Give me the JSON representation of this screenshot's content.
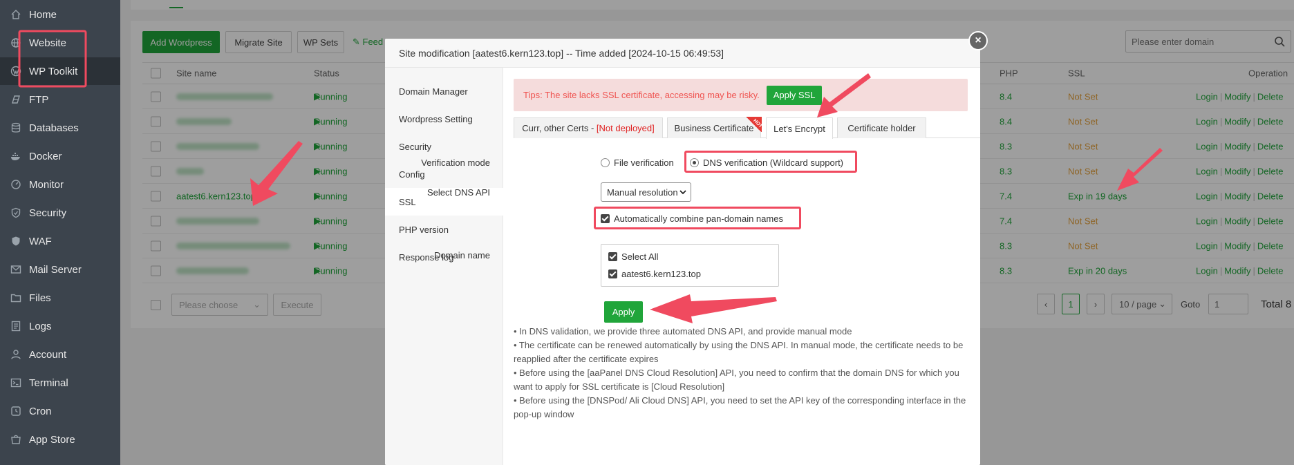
{
  "sidebar": {
    "items": [
      {
        "label": "Home",
        "icon": "home-icon"
      },
      {
        "label": "Website",
        "icon": "globe-icon"
      },
      {
        "label": "WP Toolkit",
        "icon": "wordpress-icon"
      },
      {
        "label": "FTP",
        "icon": "ftp-icon"
      },
      {
        "label": "Databases",
        "icon": "database-icon"
      },
      {
        "label": "Docker",
        "icon": "docker-icon"
      },
      {
        "label": "Monitor",
        "icon": "monitor-icon"
      },
      {
        "label": "Security",
        "icon": "shield-icon"
      },
      {
        "label": "WAF",
        "icon": "waf-icon"
      },
      {
        "label": "Mail Server",
        "icon": "mail-icon"
      },
      {
        "label": "Files",
        "icon": "folder-icon"
      },
      {
        "label": "Logs",
        "icon": "logs-icon"
      },
      {
        "label": "Account",
        "icon": "user-icon"
      },
      {
        "label": "Terminal",
        "icon": "terminal-icon"
      },
      {
        "label": "Cron",
        "icon": "clock-icon"
      },
      {
        "label": "App Store",
        "icon": "store-icon"
      }
    ]
  },
  "toolbar": {
    "add_wordpress": "Add Wordpress",
    "migrate_site": "Migrate Site",
    "wp_sets": "WP Sets",
    "feedback": "Feed",
    "search_placeholder": "Please enter domain"
  },
  "table": {
    "headers": {
      "site_name": "Site name",
      "status": "Status",
      "php": "PHP",
      "ssl": "SSL",
      "operation": "Operation"
    },
    "rows": [
      {
        "site": "",
        "status": "Running",
        "php": "8.4",
        "ssl": "Not Set",
        "ssl_ok": false
      },
      {
        "site": "",
        "status": "Running",
        "php": "8.4",
        "ssl": "Not Set",
        "ssl_ok": false
      },
      {
        "site": "",
        "status": "Running",
        "php": "8.3",
        "ssl": "Not Set",
        "ssl_ok": false
      },
      {
        "site": "",
        "status": "Running",
        "php": "8.3",
        "ssl": "Not Set",
        "ssl_ok": false
      },
      {
        "site": "aatest6.kern123.top",
        "status": "Running",
        "php": "7.4",
        "ssl": "Exp in 19 days",
        "ssl_ok": true
      },
      {
        "site": "",
        "status": "Running",
        "php": "7.4",
        "ssl": "Not Set",
        "ssl_ok": false
      },
      {
        "site": "",
        "status": "Running",
        "php": "8.3",
        "ssl": "Not Set",
        "ssl_ok": false
      },
      {
        "site": "",
        "status": "Running",
        "php": "8.3",
        "ssl": "Exp in 20 days",
        "ssl_ok": true
      }
    ],
    "ops": {
      "login": "Login",
      "modify": "Modify",
      "delete": "Delete"
    }
  },
  "footer": {
    "choose_placeholder": "Please choose",
    "execute": "Execute",
    "page": "1",
    "per_page": "10 / page",
    "goto_label": "Goto",
    "goto_value": "1",
    "total": "Total 8"
  },
  "modal": {
    "title": "Site modification [aatest6.kern123.top] -- Time added [2024-10-15 06:49:53]",
    "close": "×",
    "menu": [
      "Domain Manager",
      "Wordpress Setting",
      "Security",
      "Config",
      "SSL",
      "PHP version",
      "Response log"
    ],
    "active_menu": "SSL",
    "tips": "Tips: The site lacks SSL certificate, accessing may be risky.",
    "apply_ssl": "Apply SSL",
    "tabs": {
      "curr_prefix": "Curr, other Certs - ",
      "curr_status": "[Not deployed]",
      "business": "Business Certificate",
      "hot": "HOT",
      "letsencrypt": "Let's Encrypt",
      "holder": "Certificate holder"
    },
    "form": {
      "verification_label": "Verification mode",
      "file_verification": "File verification",
      "dns_verification": "DNS verification (Wildcard support)",
      "dns_api_label": "Select DNS API",
      "dns_api_value": "Manual resolution",
      "combine_label": "Automatically combine pan-domain names",
      "domain_label": "Domain name",
      "select_all": "Select All",
      "domain": "aatest6.kern123.top",
      "apply": "Apply"
    },
    "notes": [
      "•  In DNS validation, we provide three automated DNS API, and provide manual mode",
      "•  The certificate can be renewed automatically by using the DNS API. In manual mode, the certificate needs to be reapplied after the certificate expires",
      "•  Before using the [aaPanel DNS Cloud Resolution] API, you need to confirm that the domain DNS for which you want to apply for SSL certificate is [Cloud Resolution]",
      "•  Before using the [DNSPod/ Ali Cloud DNS] API, you need to set the API key of the corresponding interface in the pop-up window"
    ]
  },
  "colors": {
    "accent": "#20a53a",
    "highlight": "#f04a5f",
    "warning": "#e6a23c",
    "sidebar": "#3c444d"
  }
}
